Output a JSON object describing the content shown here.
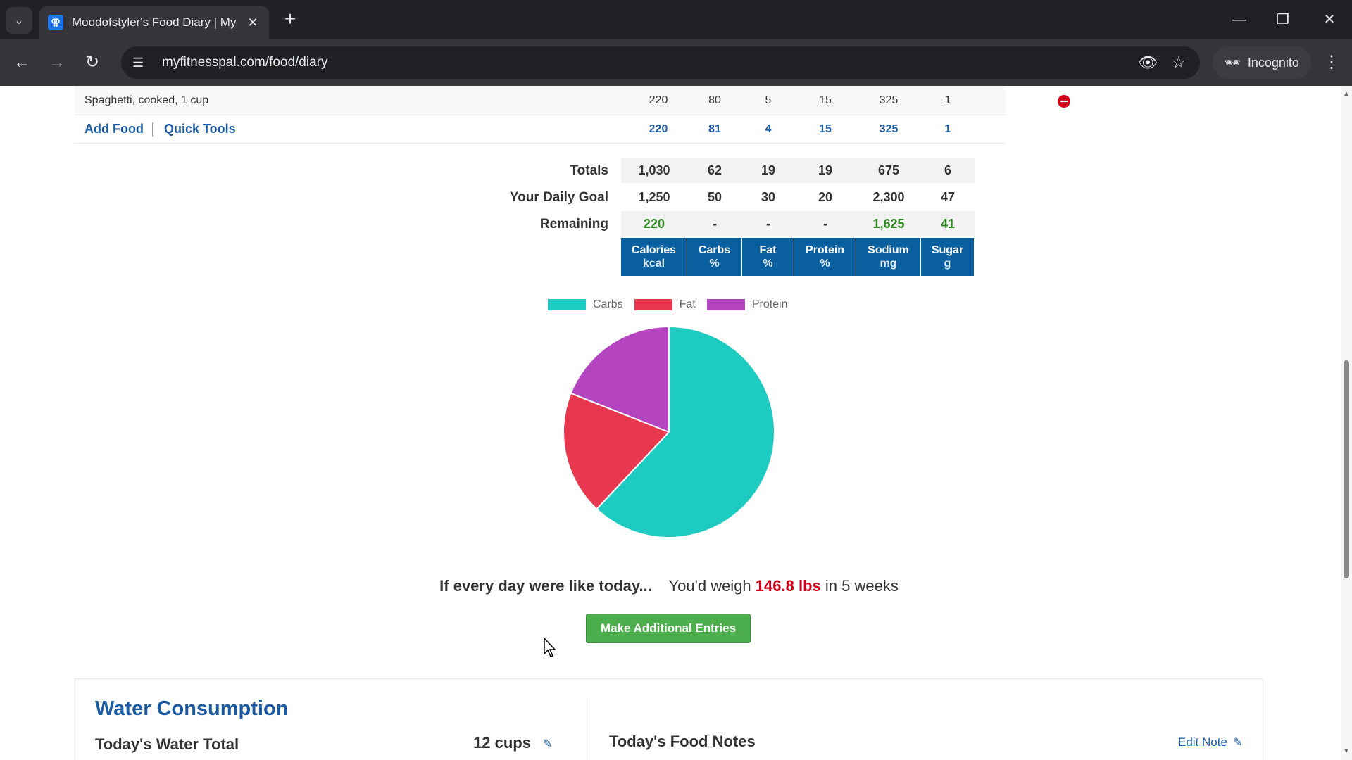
{
  "browser": {
    "tab_title": "Moodofstyler's Food Diary | My",
    "favicon_letter": "✕",
    "url": "myfitnesspal.com/food/diary",
    "incognito_label": "Incognito"
  },
  "diary": {
    "food_row": {
      "name": "Spaghetti, cooked, 1 cup",
      "values": [
        "220",
        "80",
        "5",
        "15",
        "325",
        "1"
      ]
    },
    "add_food_label": "Add Food",
    "quick_tools_label": "Quick Tools",
    "meal_totals": [
      "220",
      "81",
      "4",
      "15",
      "325",
      "1"
    ],
    "totals_label": "Totals",
    "totals": [
      "1,030",
      "62",
      "19",
      "19",
      "675",
      "6"
    ],
    "goal_label": "Your Daily Goal",
    "goal": [
      "1,250",
      "50",
      "30",
      "20",
      "2,300",
      "47"
    ],
    "remaining_label": "Remaining",
    "remaining": [
      "220",
      "-",
      "-",
      "-",
      "1,625",
      "41"
    ],
    "headers": [
      {
        "name": "Calories",
        "unit": "kcal"
      },
      {
        "name": "Carbs",
        "unit": "%"
      },
      {
        "name": "Fat",
        "unit": "%"
      },
      {
        "name": "Protein",
        "unit": "%"
      },
      {
        "name": "Sodium",
        "unit": "mg"
      },
      {
        "name": "Sugar",
        "unit": "g"
      }
    ]
  },
  "chart_data": {
    "type": "pie",
    "categories": [
      "Carbs",
      "Fat",
      "Protein"
    ],
    "values": [
      62,
      19,
      19
    ],
    "colors": [
      "#1ecbc0",
      "#e8384f",
      "#b444c0"
    ],
    "legend": "top"
  },
  "projection": {
    "lead": "If every day were like today...",
    "prefix": "You'd weigh",
    "weight": "146.8 lbs",
    "suffix": "in 5 weeks"
  },
  "make_entries_label": "Make Additional Entries",
  "water": {
    "title": "Water Consumption",
    "total_label": "Today's Water Total",
    "total_value": "12 cups"
  },
  "notes": {
    "title": "Today's Food Notes",
    "edit_label": "Edit Note"
  }
}
